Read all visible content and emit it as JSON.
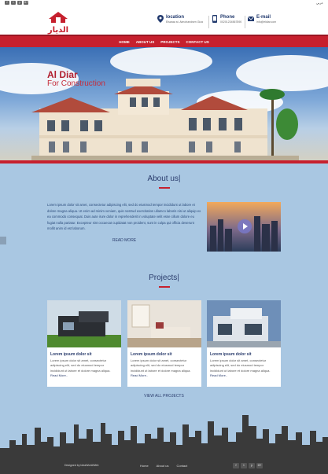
{
  "topbar": {
    "socials": [
      "f",
      "t",
      "y",
      "G+"
    ],
    "lang": "عربي"
  },
  "header": {
    "logo_text": "الديار",
    "location": {
      "title": "location",
      "value": "Elsaraa st. Almohandsen Giza"
    },
    "phone": {
      "title": "Phone",
      "value": "00201234567890"
    },
    "email": {
      "title": "E-mail",
      "value": "info@eldiar.com"
    }
  },
  "nav": {
    "items": [
      "HOME",
      "ABOUT US",
      "PROJECTS",
      "CONTACT US"
    ]
  },
  "hero": {
    "title": "Al Diar",
    "subtitle": "For Construction"
  },
  "about": {
    "title": "About us|",
    "lines": [
      "Lorem ipsum dolor sit amet, consectetur adipiscing elit, sed do eiusmod tempor incididunt ut labore et",
      "dolore magna aliqua. Ut enim ad minim veniam, quis nostrud exercitation ullamco laboris nisi ut aliquip ex",
      "ea commodo consequat. Duis aute irure dolor in reprehenderit in voluptate velit esse cillum dolore eu",
      "fugiat nulla pariatur. Excepteur sint occaecat cupidatat non proident, sunt in culpa qui officia deserunt",
      "mollit anim id est laborum."
    ],
    "read_more": "READ MORE"
  },
  "projects": {
    "title": "Projects|",
    "cards": [
      {
        "title": "Lorem ipsum dolor sit",
        "body": "Lorem ipsum dolor sit amet, consectetur adipiscing elit, sed do eiusmod tempor incididunt ut labore et dolore magna aliqua.",
        "more": "Read More.."
      },
      {
        "title": "Lorem ipsum dolor sit",
        "body": "Lorem ipsum dolor sit amet, consectetur adipiscing elit, sed do eiusmod tempor incididunt ut labore et dolore magna aliqua.",
        "more": "Read More.."
      },
      {
        "title": "Lorem ipsum dolor sit",
        "body": "Lorem ipsum dolor sit amet, consectetur adipiscing elit, sed do eiusmod tempor incididunt ut labore et dolore magna aliqua.",
        "more": "Read More.."
      }
    ],
    "view_all": "VIEW ALL PROJECTS"
  },
  "footer": {
    "copyright": "Designed by IdeaWorldWeb",
    "links": [
      "Home",
      "About us",
      "Contact"
    ],
    "socials": [
      "f",
      "t",
      "y",
      "G+"
    ]
  },
  "colors": {
    "accent": "#c6202e",
    "navy": "#2a3c6c",
    "page_bg": "#a9c7e2"
  }
}
